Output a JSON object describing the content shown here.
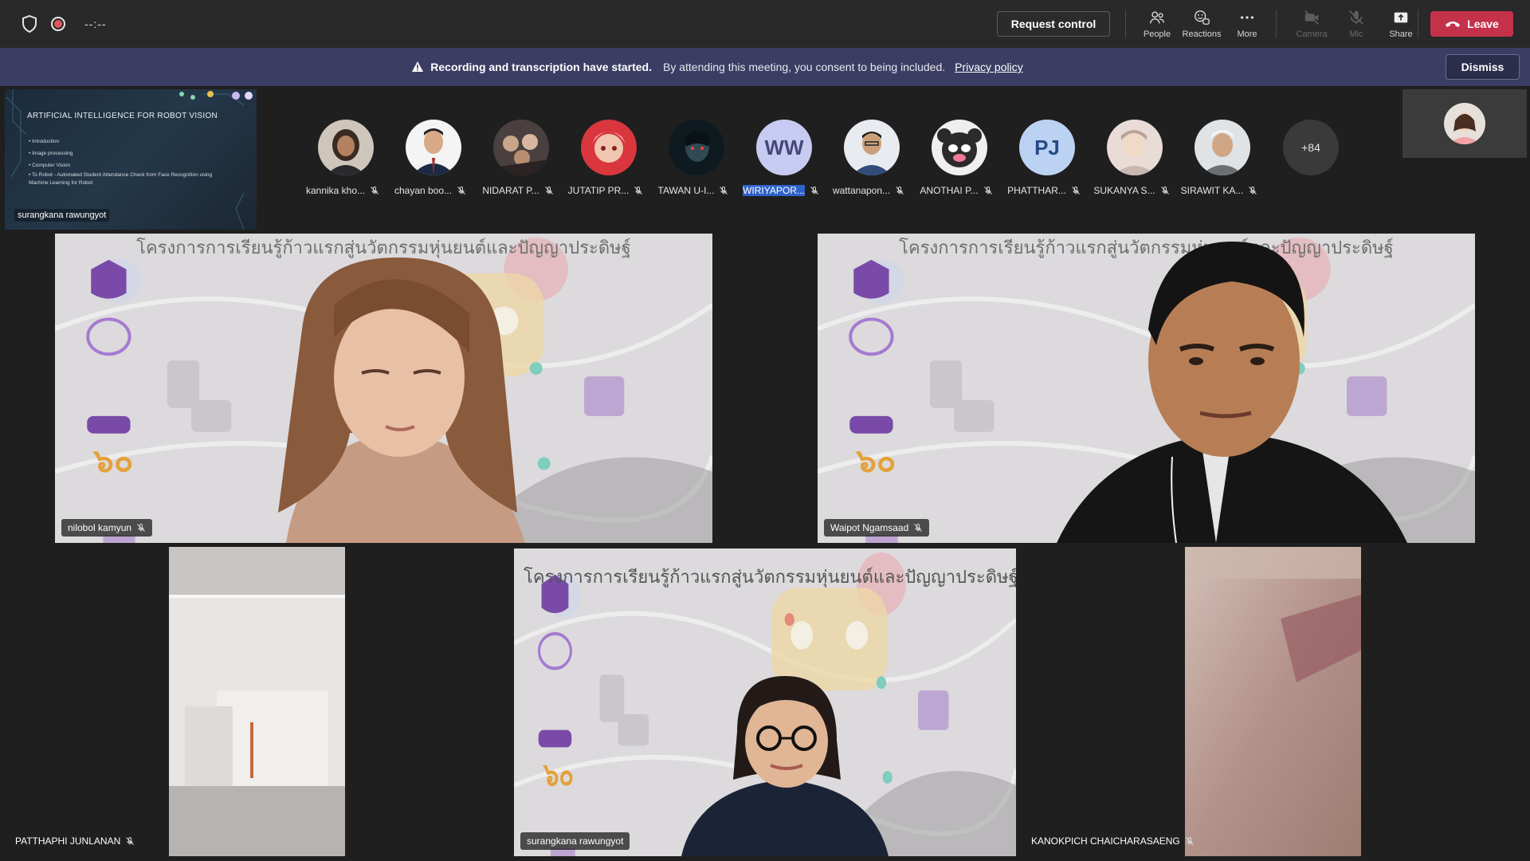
{
  "topbar": {
    "timer": "--:--",
    "request_control": "Request control",
    "people": "People",
    "reactions": "Reactions",
    "more": "More",
    "camera": "Camera",
    "mic": "Mic",
    "share": "Share",
    "leave": "Leave"
  },
  "banner": {
    "bold": "Recording and transcription have started.",
    "text": "By attending this meeting, you consent to being included.",
    "link": "Privacy policy",
    "dismiss": "Dismiss"
  },
  "shared_content": {
    "title": "ARTIFICIAL INTELLIGENCE FOR ROBOT VISION",
    "bullets": [
      "Introduction",
      "Image processing",
      "Computer Vision",
      "To Robot - Automated Student Attendance Check from Face Recognition using Machine Learning for Robot"
    ],
    "presenter": "surangkana rawungyot"
  },
  "participants": [
    {
      "name": "kannika kho..."
    },
    {
      "name": "chayan boo..."
    },
    {
      "name": "NIDARAT P..."
    },
    {
      "name": "JUTATIP PR..."
    },
    {
      "name": "TAWAN U-I..."
    },
    {
      "name": "WIRIYAPOR...",
      "initials": "WW"
    },
    {
      "name": "wattanapon..."
    },
    {
      "name": "ANOTHAI P..."
    },
    {
      "name": "PHATTHAR...",
      "initials": "PJ"
    },
    {
      "name": "SUKANYA S..."
    },
    {
      "name": "SIRAWIT KA..."
    }
  ],
  "more_count": "+84",
  "tiles": {
    "header": "โครงการการเรียนรู้ก้าวแรกสู่นวัตกรรมหุ่นยนต์และปัญญาประดิษฐ์",
    "t1_name": "nilobol kamyun",
    "t2_name": "Waipot Ngamsaad",
    "t3_name": "PATTHAPHI JUNLANAN",
    "t4_name": "surangkana rawungyot",
    "t5_name": "KANOKPICH CHAICHARASAENG"
  },
  "colors": {
    "leave": "#c4314b",
    "banner": "#3b3d63",
    "active_outline": "#8b8dd9"
  }
}
